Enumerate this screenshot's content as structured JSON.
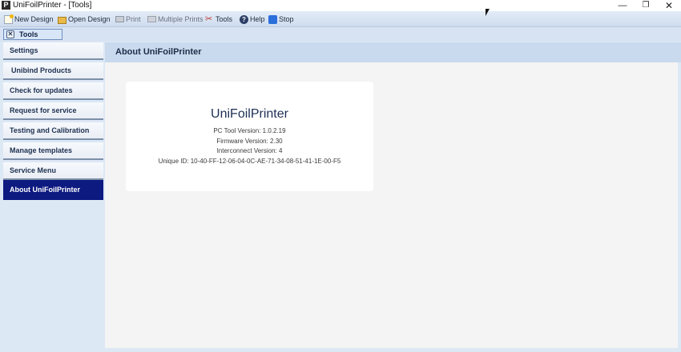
{
  "window": {
    "title": "UniFoilPrinter - [Tools]",
    "app_icon_letter": "P",
    "minimize_glyph": "—",
    "maximize_glyph": "❐",
    "close_glyph": "✕"
  },
  "toolbar": {
    "items": [
      {
        "label": "New Design",
        "icon": "new-document-icon",
        "enabled": true
      },
      {
        "label": "Open Design",
        "icon": "open-folder-icon",
        "enabled": true
      },
      {
        "label": "Print",
        "icon": "printer-icon",
        "enabled": false
      },
      {
        "label": "Multiple Prints",
        "icon": "multiple-printers-icon",
        "enabled": false
      },
      {
        "label": "Tools",
        "icon": "tools-icon",
        "enabled": true
      },
      {
        "label": "Help",
        "icon": "help-icon",
        "enabled": true
      },
      {
        "label": "Stop",
        "icon": "stop-icon",
        "enabled": true
      }
    ]
  },
  "tabs": {
    "active_label": "Tools",
    "close_glyph": "✕"
  },
  "sidebar": {
    "items": [
      {
        "label": "Settings"
      },
      {
        "label": "Unibind Products"
      },
      {
        "label": "Check for updates"
      },
      {
        "label": "Request for service"
      },
      {
        "label": "Testing and Calibration"
      },
      {
        "label": "Manage templates"
      },
      {
        "label": "Service Menu"
      },
      {
        "label": "About UniFoilPrinter",
        "active": true
      }
    ]
  },
  "content": {
    "header": "About UniFoilPrinter",
    "about": {
      "product_name": "UniFoilPrinter",
      "pc_tool_version": "PC Tool Version: 1.0.2.19",
      "firmware_version": "Firmware Version: 2.30",
      "interconnect_version": "Interconnect Version: 4",
      "unique_id": "Unique ID: 10-40-FF-12-06-04-0C-AE-71-34-08-51-41-1E-00-F5"
    }
  },
  "colors": {
    "active_nav": "#0d1a80",
    "header_bg": "#c9daee",
    "content_bg": "#f4f4f4"
  }
}
